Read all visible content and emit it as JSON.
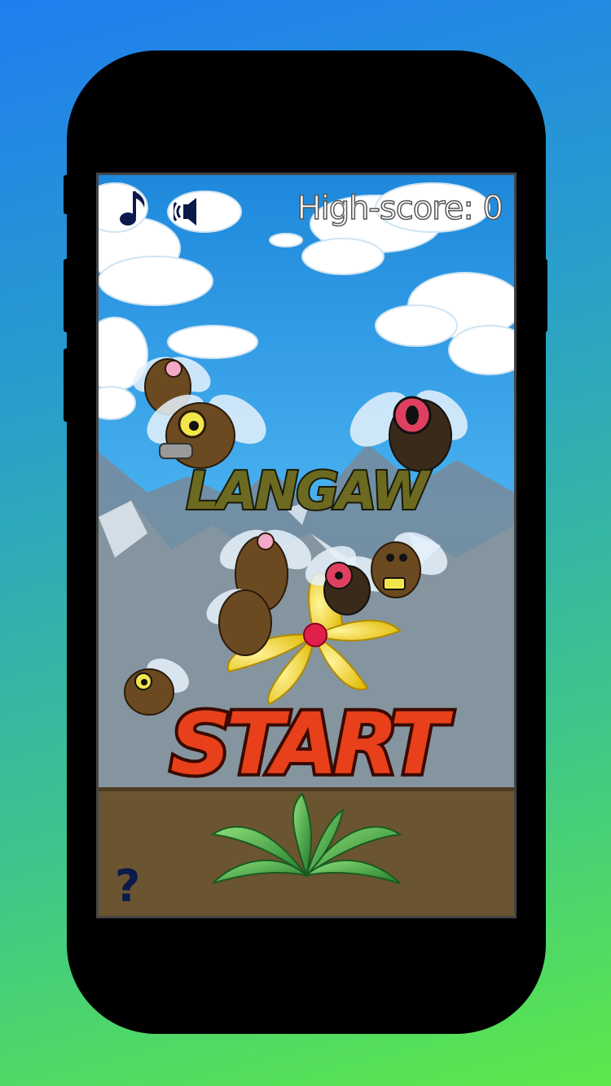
{
  "hud": {
    "music_icon": "music-note-icon",
    "sound_icon": "speaker-icon",
    "high_score_text": "High-score: 0"
  },
  "title": {
    "logo_text": "LANGAW"
  },
  "start_button": {
    "label": "START"
  },
  "help_button": {
    "label": "?"
  },
  "colors": {
    "sky": "#3aa6ea",
    "ground": "#6b5430",
    "start_text": "#e8401a",
    "start_outline": "#3a0a00",
    "logo_text": "#6b6a20"
  }
}
